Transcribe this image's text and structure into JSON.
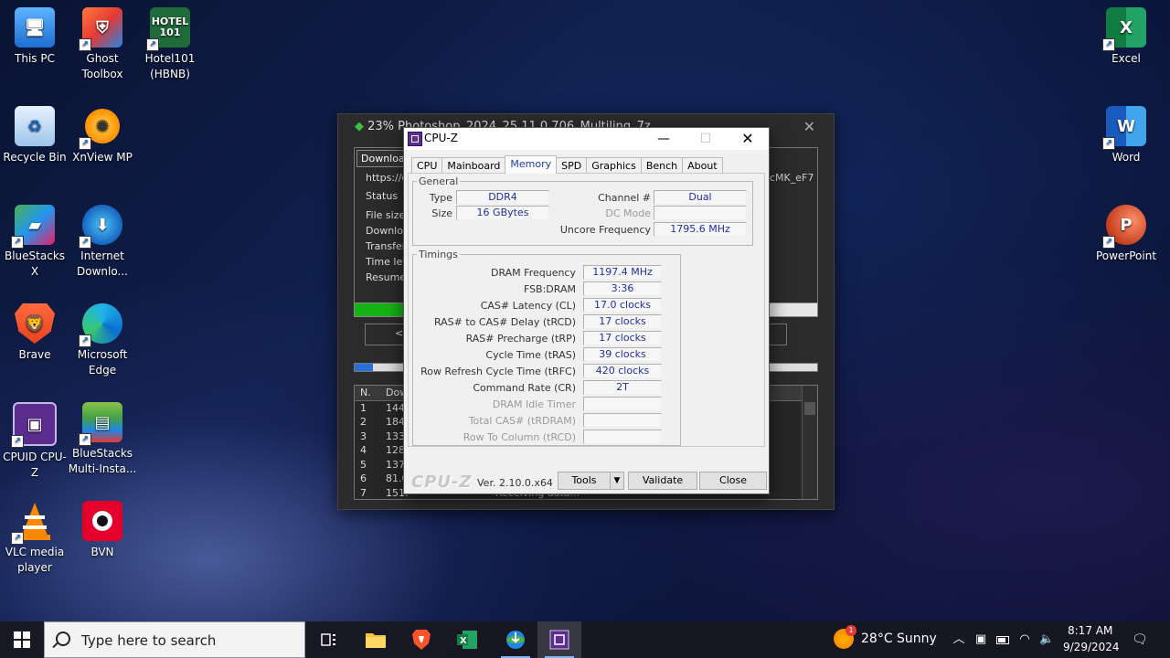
{
  "desktop_icons": [
    {
      "label": "This PC",
      "icon": "computer-icon"
    },
    {
      "label": "Ghost Toolbox",
      "icon": "ghost-toolbox-icon"
    },
    {
      "label": "Hotel101 (HBNB)",
      "icon": "hotel101-icon",
      "logo_text": "HOTEL 101"
    },
    {
      "label": "Recycle Bin",
      "icon": "recycle-bin-icon"
    },
    {
      "label": "XnView MP",
      "icon": "xnview-icon"
    },
    {
      "label": "BlueStacks X",
      "icon": "bluestacks-icon"
    },
    {
      "label": "Internet Downlo...",
      "icon": "internet-download-manager-icon"
    },
    {
      "label": "Brave",
      "icon": "brave-icon"
    },
    {
      "label": "Microsoft Edge",
      "icon": "edge-icon"
    },
    {
      "label": "CPUID CPU-Z",
      "icon": "cpuz-icon"
    },
    {
      "label": "BlueStacks Multi-Insta...",
      "icon": "bluestacks-multi-icon"
    },
    {
      "label": "VLC media player",
      "icon": "vlc-icon"
    },
    {
      "label": "BVN",
      "icon": "bvn-icon"
    },
    {
      "label": "Excel",
      "icon": "excel-icon"
    },
    {
      "label": "Word",
      "icon": "word-icon"
    },
    {
      "label": "PowerPoint",
      "icon": "powerpoint-icon"
    }
  ],
  "download_window": {
    "title": "23% Photoshop_2024_25.11.0.706_Multiling_7z",
    "tab": "Download",
    "url_partial": "https://d",
    "url_tail": "cMK_eF7",
    "labels": [
      "Status",
      "File size",
      "Downloa",
      "Transfer",
      "Time left",
      "Resume"
    ],
    "progress_percent": 23,
    "button_partial": "<",
    "list_headers": [
      "N.",
      "Dow"
    ],
    "list_rows": [
      {
        "n": "1",
        "v": "144"
      },
      {
        "n": "2",
        "v": "184"
      },
      {
        "n": "3",
        "v": "133"
      },
      {
        "n": "4",
        "v": "128"
      },
      {
        "n": "5",
        "v": "137"
      },
      {
        "n": "6",
        "v": "81.0"
      },
      {
        "n": "7",
        "v": "151."
      }
    ],
    "status_partial": "Receiving data..."
  },
  "cpuz": {
    "title": "CPU-Z",
    "tabs": [
      "CPU",
      "Mainboard",
      "Memory",
      "SPD",
      "Graphics",
      "Bench",
      "About"
    ],
    "active_tab": "Memory",
    "general": {
      "legend": "General",
      "type_label": "Type",
      "type_value": "DDR4",
      "size_label": "Size",
      "size_value": "16 GBytes",
      "channel_label": "Channel #",
      "channel_value": "Dual",
      "dcmode_label": "DC Mode",
      "dcmode_value": "",
      "uncore_label": "Uncore Frequency",
      "uncore_value": "1795.6 MHz"
    },
    "timings": {
      "legend": "Timings",
      "rows": [
        {
          "label": "DRAM Frequency",
          "value": "1197.4 MHz",
          "dim": false
        },
        {
          "label": "FSB:DRAM",
          "value": "3:36",
          "dim": false
        },
        {
          "label": "CAS# Latency (CL)",
          "value": "17.0 clocks",
          "dim": false
        },
        {
          "label": "RAS# to CAS# Delay (tRCD)",
          "value": "17 clocks",
          "dim": false
        },
        {
          "label": "RAS# Precharge (tRP)",
          "value": "17 clocks",
          "dim": false
        },
        {
          "label": "Cycle Time (tRAS)",
          "value": "39 clocks",
          "dim": false
        },
        {
          "label": "Row Refresh Cycle Time (tRFC)",
          "value": "420 clocks",
          "dim": false
        },
        {
          "label": "Command Rate (CR)",
          "value": "2T",
          "dim": false
        },
        {
          "label": "DRAM Idle Timer",
          "value": "",
          "dim": true
        },
        {
          "label": "Total CAS# (tRDRAM)",
          "value": "",
          "dim": true
        },
        {
          "label": "Row To Column (tRCD)",
          "value": "",
          "dim": true
        }
      ]
    },
    "footer": {
      "logo": "CPU-Z",
      "version": "Ver. 2.10.0.x64",
      "tools_label": "Tools",
      "validate_label": "Validate",
      "close_label": "Close"
    }
  },
  "taskbar": {
    "search_placeholder": "Type here to search",
    "weather": "28°C  Sunny",
    "weather_badge": "1",
    "time": "8:17 AM",
    "date": "9/29/2024"
  }
}
